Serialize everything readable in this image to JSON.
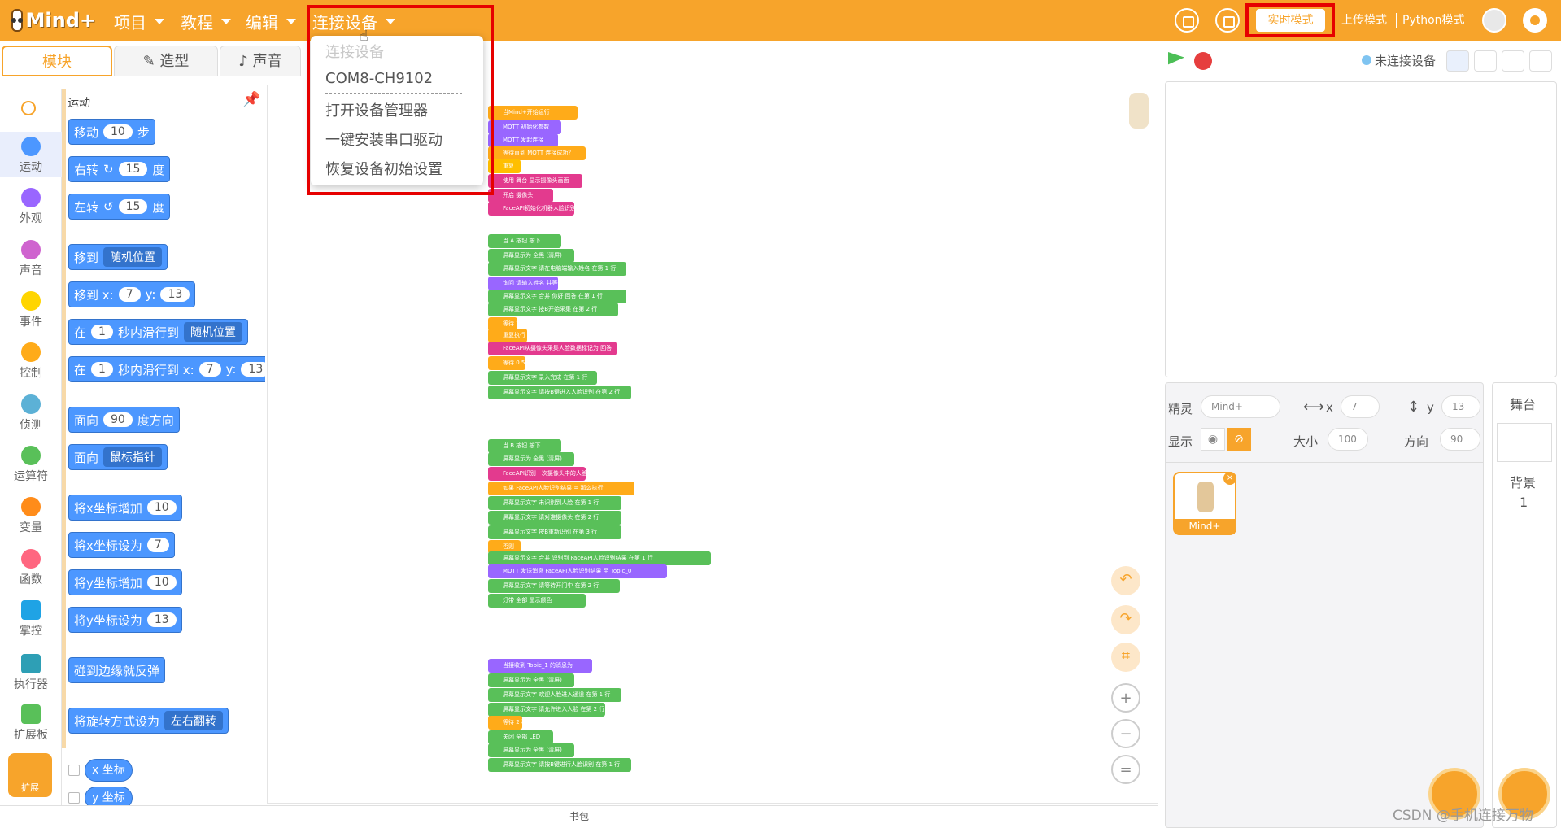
{
  "app": {
    "logo_text": "Mind+"
  },
  "topbar": {
    "menus": [
      "项目",
      "教程",
      "编辑",
      "连接设备"
    ],
    "modes": [
      "实时模式",
      "上传模式",
      "Python模式"
    ]
  },
  "connect_menu": {
    "items": [
      "连接设备",
      "COM8-CH9102",
      "打开设备管理器",
      "一键安装串口驱动",
      "恢复设备初始设置"
    ]
  },
  "tabs": [
    "模块",
    "造型",
    "声音"
  ],
  "categories": [
    {
      "label": "运动",
      "color": "#4c97ff"
    },
    {
      "label": "外观",
      "color": "#9966ff"
    },
    {
      "label": "声音",
      "color": "#cf63cf"
    },
    {
      "label": "事件",
      "color": "#ffd500"
    },
    {
      "label": "控制",
      "color": "#ffab19"
    },
    {
      "label": "侦测",
      "color": "#5cb1d6"
    },
    {
      "label": "运算符",
      "color": "#59c059"
    },
    {
      "label": "变量",
      "color": "#ff8c1a"
    },
    {
      "label": "函数",
      "color": "#ff6680"
    },
    {
      "label": "掌控",
      "color": "#1fa3e5"
    },
    {
      "label": "执行器",
      "color": "#2e9fb5"
    },
    {
      "label": "扩展板",
      "color": "#59c059"
    }
  ],
  "extension_button": "扩展",
  "palette": {
    "title": "运动",
    "blocks": {
      "move": {
        "pre": "移动",
        "val": "10",
        "post": "步"
      },
      "turn_right": {
        "pre": "右转",
        "icon": "↻",
        "val": "15",
        "post": "度"
      },
      "turn_left": {
        "pre": "左转",
        "icon": "↺",
        "val": "15",
        "post": "度"
      },
      "goto": {
        "pre": "移到",
        "drop": "随机位置"
      },
      "goto_xy": {
        "pre": "移到 x:",
        "x": "7",
        "mid": "y:",
        "y": "13"
      },
      "glide": {
        "pre": "在",
        "val": "1",
        "mid": "秒内滑行到",
        "drop": "随机位置"
      },
      "glide_xy": {
        "pre": "在",
        "val": "1",
        "mid": "秒内滑行到 x:",
        "x": "7",
        "mid2": "y:",
        "y": "13"
      },
      "point_dir": {
        "pre": "面向",
        "val": "90",
        "post": "度方向"
      },
      "point_towards": {
        "pre": "面向",
        "drop": "鼠标指针"
      },
      "change_x": {
        "pre": "将x坐标增加",
        "val": "10"
      },
      "set_x": {
        "pre": "将x坐标设为",
        "val": "7"
      },
      "change_y": {
        "pre": "将y坐标增加",
        "val": "10"
      },
      "set_y": {
        "pre": "将y坐标设为",
        "val": "13"
      },
      "bounce": {
        "pre": "碰到边缘就反弹"
      },
      "rotation": {
        "pre": "将旋转方式设为",
        "drop": "左右翻转"
      },
      "x_pos": "x 坐标",
      "y_pos": "y 坐标"
    }
  },
  "scripts": [
    "当Mind+开始运行",
    "MQTT 初始化参数",
    "MQTT 发起连接",
    "等待直到 MQTT 连接成功？",
    "重复",
    "使用 舞台 显示摄像头画面",
    "开启 摄像头",
    "FaceAPI初始化机器人脸识别",
    "当 A 按钮 按下",
    "屏幕显示为 全黑 (清屏)",
    "屏幕显示文字 请在电脑端输入姓名 在第 1 行",
    "询问 请输入姓名 并等待",
    "屏幕显示文字 合并 你好 回答 在第 1 行",
    "屏幕显示文字 按B开始采集 在第 2 行",
    "等待 2 秒",
    "重复执行 5 次",
    "FaceAPI从摄像头采集人脸数据标记为 回答",
    "等待 0.5 秒",
    "屏幕显示文字 录入完成 在第 1 行",
    "屏幕显示文字 请按B键进入人脸识别 在第 2 行",
    "当 B 按钮 按下",
    "屏幕显示为 全黑 (清屏)",
    "FaceAPI识别一次摄像头中的人脸",
    "如果 FaceAPI人脸识别结果 = 那么执行",
    "屏幕显示文字 未识别到人脸 在第 1 行",
    "屏幕显示文字 请对准摄像头 在第 2 行",
    "屏幕显示文字 按B重新识别 在第 3 行",
    "否则",
    "屏幕显示文字 合并 识别到 FaceAPI人脸识别结果 在第 1 行",
    "MQTT 发送消息 FaceAPI人脸识别结果 至 Topic_0",
    "屏幕显示文字 请等待开门中 在第 2 行",
    "灯带 全部 显示颜色",
    "当接收到 Topic_1 的消息为 ",
    "屏幕显示为 全黑 (清屏)",
    "屏幕显示文字 欢迎人脸进入通道 在第 1 行",
    "屏幕显示文字 请允许进入人脸 在第 2 行",
    "等待 2 秒",
    "关闭 全部 LED",
    "屏幕显示为 全黑 (清屏)",
    "屏幕显示文字 请按B键进行人脸识别 在第 1 行"
  ],
  "bottom_bar": "书包",
  "stage_header": {
    "status": "未连接设备"
  },
  "sprite_panel": {
    "sprite_label": "精灵",
    "sprite_name": "Mind+",
    "x_label": "x",
    "x": "7",
    "y_label": "y",
    "y": "13",
    "show_label": "显示",
    "size_label": "大小",
    "size": "100",
    "dir_label": "方向",
    "dir": "90",
    "sprite_card": "Mind+"
  },
  "stage_column": {
    "title": "舞台",
    "backdrop_label": "背景",
    "backdrop_count": "1"
  },
  "watermark": "CSDN @手机连接万物",
  "colors": {
    "brand": "#f7a42b",
    "highlight_box": "#e60000"
  }
}
